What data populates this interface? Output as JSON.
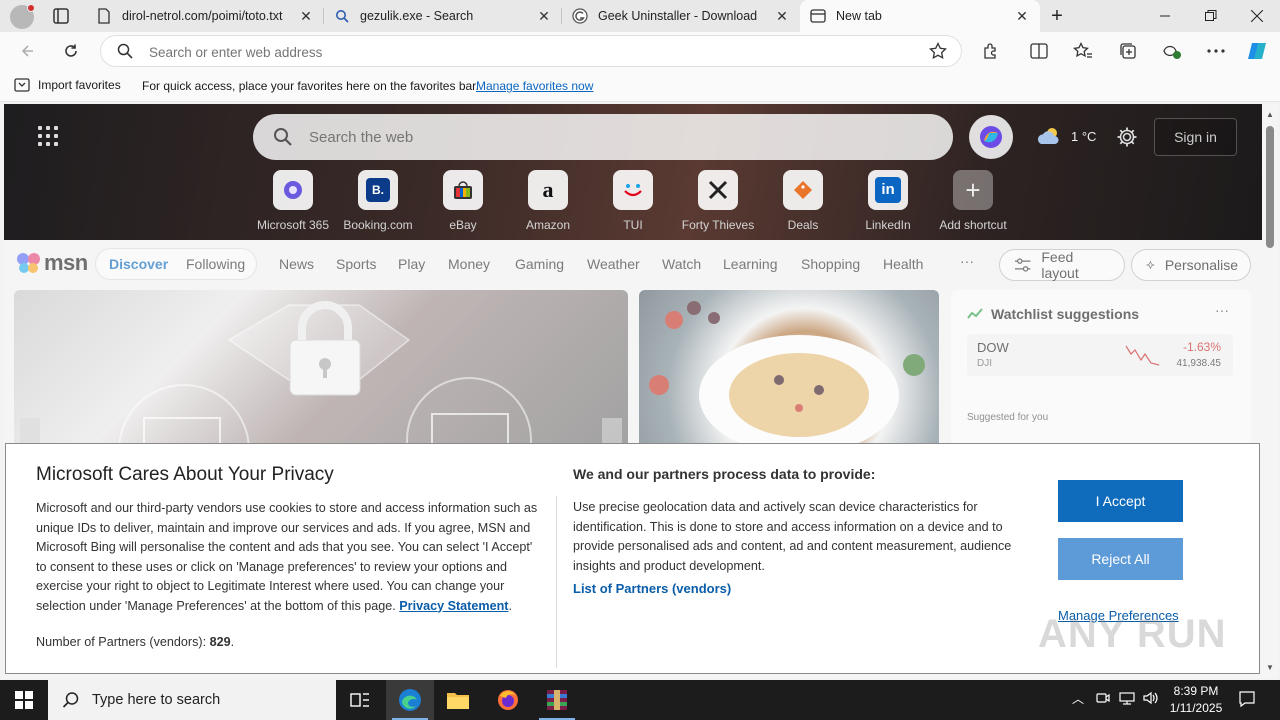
{
  "browser": {
    "tabs": [
      {
        "title": "dirol-netrol.com/poimi/toto.txt",
        "active": false
      },
      {
        "title": "gezulik.exe - Search",
        "active": false
      },
      {
        "title": "Geek Uninstaller - Download",
        "active": false
      },
      {
        "title": "New tab",
        "active": true
      }
    ],
    "address_placeholder": "Search or enter web address",
    "favorites_bar": {
      "import_label": "Import favorites",
      "hint": "For quick access, place your favorites here on the favorites bar.",
      "manage_link": "Manage favorites now"
    }
  },
  "newtab": {
    "search_placeholder": "Search the web",
    "weather_temp": "1 °C",
    "signin_label": "Sign in",
    "shortcuts": [
      {
        "label": "Microsoft 365",
        "icon": "microsoft-365-icon",
        "glyph": ""
      },
      {
        "label": "Booking.com",
        "icon": "booking-icon",
        "glyph": "B."
      },
      {
        "label": "eBay",
        "icon": "ebay-icon",
        "glyph": ""
      },
      {
        "label": "Amazon",
        "icon": "amazon-icon",
        "glyph": "a"
      },
      {
        "label": "TUI",
        "icon": "tui-icon",
        "glyph": ""
      },
      {
        "label": "Forty Thieves",
        "icon": "forty-thieves-icon",
        "glyph": ""
      },
      {
        "label": "Deals",
        "icon": "deals-icon",
        "glyph": ""
      },
      {
        "label": "LinkedIn",
        "icon": "linkedin-icon",
        "glyph": "in"
      },
      {
        "label": "Add shortcut",
        "icon": "plus-icon",
        "glyph": "+"
      }
    ]
  },
  "msn": {
    "logo_text": "msn",
    "pills": [
      "Discover",
      "Following"
    ],
    "nav": [
      "News",
      "Sports",
      "Play",
      "Money",
      "Gaming",
      "Weather",
      "Watch",
      "Learning",
      "Shopping",
      "Health"
    ],
    "more": "···",
    "feed_layout": "Feed layout",
    "personalise": "Personalise",
    "watchlist": {
      "title": "Watchlist suggestions",
      "more": "···",
      "stock": {
        "symbol": "DOW",
        "exchange": "DJI",
        "change": "-1.63%",
        "value": "41,938.45"
      },
      "suggested_label": "Suggested for you"
    }
  },
  "privacy": {
    "title": "Microsoft Cares About Your Privacy",
    "body": "Microsoft and our third-party vendors use cookies to store and access information such as unique IDs to deliver, maintain and improve our services and ads. If you agree, MSN and Microsoft Bing will personalise the content and ads that you see. You can select 'I Accept' to consent to these uses or click on 'Manage preferences' to review your options and exercise your right to object to Legitimate Interest where used.  You can change your selection under 'Manage Preferences' at the bottom of this page.",
    "privacy_link": "Privacy Statement",
    "partners_label": "Number of Partners (vendors):",
    "partners_count": "829",
    "process_title": "We and our partners process data to provide:",
    "process_body": "Use precise geolocation data and actively scan device characteristics for identification. This is done to store and access information on a device and to provide personalised ads and content, ad and content measurement, audience insights and product development.",
    "list_partners": "List of Partners (vendors)",
    "accept": "I Accept",
    "reject": "Reject All",
    "manage": "Manage Preferences"
  },
  "watermark": "ANY RUN",
  "taskbar": {
    "search_placeholder": "Type here to search",
    "time": "8:39 PM",
    "date": "1/11/2025"
  },
  "colors": {
    "accent": "#0f6cbd",
    "reject": "#5d9ad8",
    "link": "#0a5da8",
    "negative": "#c62828"
  }
}
